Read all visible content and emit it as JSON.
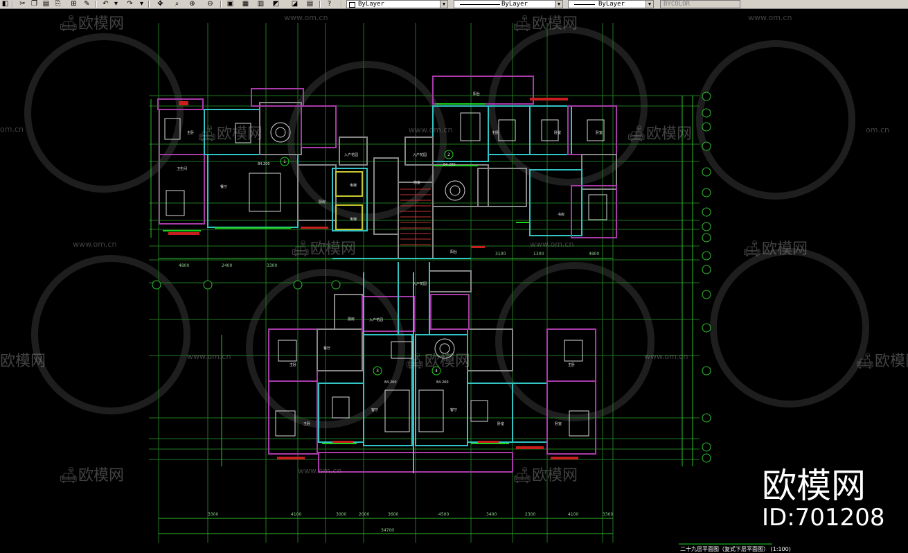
{
  "toolbar": {
    "layer_combo": "ByLayer",
    "linetype_combo": "ByLayer",
    "lineweight_combo": "ByLayer",
    "plotstyle_combo": "BYCOLOR"
  },
  "watermarks": {
    "brand": "欧模网",
    "url": "www.om.cn",
    "url_short": "om.cn",
    "big_brand": "欧模网",
    "big_id": "ID:701208"
  },
  "drawing": {
    "title": "二十九层平面图（复式下层平面图）",
    "scale_note": "(1:100)",
    "overall_dim": "34700",
    "bottom_dims": [
      "3300",
      "4100",
      "3000",
      "2000",
      "3600",
      "4500",
      "3400",
      "2300",
      "4100",
      "3300"
    ],
    "mid_dims": [
      "4800",
      "2400",
      "3300",
      "3100",
      "1300",
      "4800"
    ],
    "room_labels": [
      "主卧",
      "卧室",
      "客厅",
      "餐厅",
      "厨房",
      "卫生间",
      "入户花园",
      "电梯",
      "前室",
      "阳台",
      "书房"
    ],
    "elev_labels": [
      "84.200",
      "84.200",
      "84.200",
      "84.200"
    ],
    "unit_tags": [
      "1",
      "2",
      "3",
      "4"
    ]
  }
}
